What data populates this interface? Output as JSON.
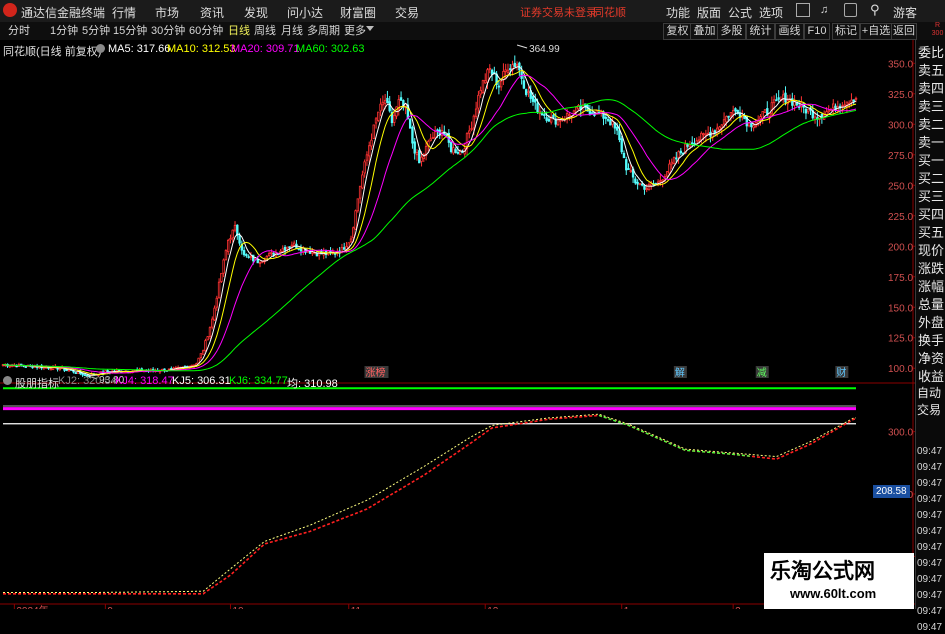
{
  "menubar": {
    "app_name": "通达信金融终端",
    "items": [
      "行情",
      "市场",
      "资讯",
      "发现",
      "问小达",
      "财富圈",
      "交易"
    ],
    "warning": "证券交易未登录",
    "brand": "同花顺",
    "right_items": [
      "功能",
      "版面",
      "公式",
      "选项"
    ],
    "guest": "游客"
  },
  "toolbar": {
    "periods": [
      "分时",
      "1分钟",
      "5分钟",
      "15分钟",
      "30分钟",
      "60分钟",
      "日线",
      "周线",
      "月线",
      "多周期",
      "更多"
    ],
    "active_period": "日线",
    "buttons": [
      "复权",
      "叠加",
      "多股",
      "统计",
      "画线",
      "F10",
      "标记",
      "+自选",
      "返回"
    ]
  },
  "stock": {
    "title": "同花顺(日线 前复权)",
    "ma5": "MA5: 317.66",
    "ma10": "MA10: 312.53",
    "ma20": "MA20: 309.71",
    "ma60": "MA60: 302.63"
  },
  "indicator": {
    "title": "股朋指标",
    "kj2": "KJ2: 320.54",
    "kj4": "KJ4: 318.47",
    "kj5": "KJ5: 306.31",
    "kj6": "KJ6: 334.77",
    "avg": "均: 310.98",
    "current_value": "208.58"
  },
  "side_panel": {
    "labels": [
      "委比",
      "卖五",
      "卖四",
      "卖三",
      "卖二",
      "卖一",
      "买一",
      "买二",
      "买三",
      "买四",
      "买五",
      "现价",
      "涨跌",
      "涨幅",
      "总量",
      "外盘",
      "换手",
      "净资",
      "收益"
    ],
    "buttons": [
      "自动",
      "交易"
    ],
    "times": [
      "09:47",
      "09:47",
      "09:47",
      "09:47",
      "09:47",
      "09:47",
      "09:47",
      "09:47",
      "09:47",
      "09:47",
      "09:47",
      "09:47"
    ],
    "top_small": "R\n300"
  },
  "watermark": {
    "line1": "乐淘公式网",
    "line2": "www.60lt.com"
  },
  "colors": {
    "up": "#ff3232",
    "down": "#54fcfc",
    "ma5": "#ffffff",
    "ma10": "#ffff00",
    "ma20": "#ff00ff",
    "ma60": "#00ff00",
    "kj2": "#888888",
    "kj4": "#ff00ff",
    "kj5": "#ffffff",
    "kj6": "#00ff00"
  },
  "chart_data": [
    {
      "type": "candlestick",
      "title": "同花顺(日线 前复权)",
      "ylim": [
        92,
        365
      ],
      "y_ticks": [
        100,
        125,
        150,
        175,
        200,
        225,
        250,
        275,
        300,
        325,
        350
      ],
      "x_tick_labels": [
        "2024年",
        "9",
        "10",
        "11",
        "12",
        "1",
        "2"
      ],
      "x_tick_index": [
        5,
        45,
        100,
        152,
        212,
        272,
        321
      ],
      "annotations": [
        {
          "text": "364.99",
          "index": 226,
          "value": 364.99
        },
        {
          "text": "93.80",
          "index": 37,
          "value": 93.8
        }
      ],
      "event_markers": [
        {
          "text": "涨榜",
          "index": 162
        },
        {
          "text": "解",
          "index": 298
        },
        {
          "text": "减",
          "index": 334
        },
        {
          "text": "财",
          "index": 369
        }
      ],
      "keyframes": [
        [
          0,
          103
        ],
        [
          8,
          102
        ],
        [
          18,
          101
        ],
        [
          25,
          100
        ],
        [
          32,
          97
        ],
        [
          37,
          94
        ],
        [
          45,
          97
        ],
        [
          55,
          98
        ],
        [
          65,
          98
        ],
        [
          75,
          99
        ],
        [
          80,
          101
        ],
        [
          85,
          104
        ],
        [
          88,
          115
        ],
        [
          92,
          140
        ],
        [
          96,
          178
        ],
        [
          99,
          205
        ],
        [
          102,
          215
        ],
        [
          104,
          205
        ],
        [
          106,
          192
        ],
        [
          112,
          188
        ],
        [
          120,
          195
        ],
        [
          127,
          202
        ],
        [
          133,
          197
        ],
        [
          139,
          194
        ],
        [
          144,
          194
        ],
        [
          149,
          197
        ],
        [
          153,
          207
        ],
        [
          157,
          250
        ],
        [
          161,
          283
        ],
        [
          165,
          310
        ],
        [
          168,
          320
        ],
        [
          171,
          302
        ],
        [
          174,
          318
        ],
        [
          177,
          313
        ],
        [
          180,
          285
        ],
        [
          183,
          268
        ],
        [
          188,
          288
        ],
        [
          193,
          296
        ],
        [
          197,
          280
        ],
        [
          202,
          278
        ],
        [
          206,
          300
        ],
        [
          210,
          330
        ],
        [
          214,
          345
        ],
        [
          218,
          332
        ],
        [
          222,
          348
        ],
        [
          226,
          350
        ],
        [
          230,
          328
        ],
        [
          234,
          315
        ],
        [
          238,
          308
        ],
        [
          242,
          303
        ],
        [
          248,
          307
        ],
        [
          254,
          313
        ],
        [
          260,
          310
        ],
        [
          266,
          305
        ],
        [
          270,
          293
        ],
        [
          274,
          265
        ],
        [
          278,
          253
        ],
        [
          283,
          248
        ],
        [
          288,
          252
        ],
        [
          292,
          262
        ],
        [
          297,
          275
        ],
        [
          302,
          285
        ],
        [
          308,
          290
        ],
        [
          314,
          297
        ],
        [
          319,
          308
        ],
        [
          323,
          312
        ],
        [
          328,
          300
        ],
        [
          333,
          305
        ],
        [
          338,
          315
        ],
        [
          344,
          322
        ],
        [
          348,
          318
        ],
        [
          353,
          312
        ],
        [
          358,
          307
        ],
        [
          364,
          312
        ],
        [
          369,
          318
        ],
        [
          374,
          322
        ]
      ],
      "series": [
        {
          "name": "MA5",
          "value": 317.66
        },
        {
          "name": "MA10",
          "value": 312.53
        },
        {
          "name": "MA20",
          "value": 309.71
        },
        {
          "name": "MA60",
          "value": 302.63
        }
      ]
    },
    {
      "type": "line",
      "title": "股朋指标",
      "ylim": [
        165,
        335
      ],
      "y_ticks": [
        200,
        250,
        300
      ],
      "hlines": [
        {
          "value": 334.77,
          "color": "#00ff00"
        },
        {
          "value": 320.54,
          "color": "#888888"
        },
        {
          "value": 318.47,
          "color": "#ff00ff"
        },
        {
          "value": 306.31,
          "color": "#ffffff"
        }
      ],
      "series": [
        {
          "name": "KJ4",
          "keyframes": [
            [
              0,
              170
            ],
            [
              40,
              170
            ],
            [
              88,
              170
            ],
            [
              100,
              185
            ],
            [
              115,
              210
            ],
            [
              135,
              220
            ],
            [
              160,
              238
            ],
            [
              185,
              265
            ],
            [
              205,
              290
            ],
            [
              215,
              303
            ],
            [
              240,
              310
            ],
            [
              262,
              313
            ],
            [
              275,
              305
            ],
            [
              300,
              285
            ],
            [
              320,
              282
            ],
            [
              340,
              278
            ],
            [
              355,
              290
            ],
            [
              374,
              310
            ]
          ]
        },
        {
          "name": "KJ2",
          "keyframes": [
            [
              0,
              171
            ],
            [
              40,
              171
            ],
            [
              88,
              172
            ],
            [
              100,
              190
            ],
            [
              115,
              212
            ],
            [
              135,
              225
            ],
            [
              160,
              245
            ],
            [
              185,
              272
            ],
            [
              205,
              295
            ],
            [
              215,
              305
            ],
            [
              240,
              311
            ],
            [
              262,
              314
            ],
            [
              275,
              306
            ],
            [
              300,
              286
            ],
            [
              320,
              283
            ],
            [
              340,
              280
            ],
            [
              355,
              292
            ],
            [
              374,
              311
            ]
          ]
        }
      ]
    }
  ]
}
